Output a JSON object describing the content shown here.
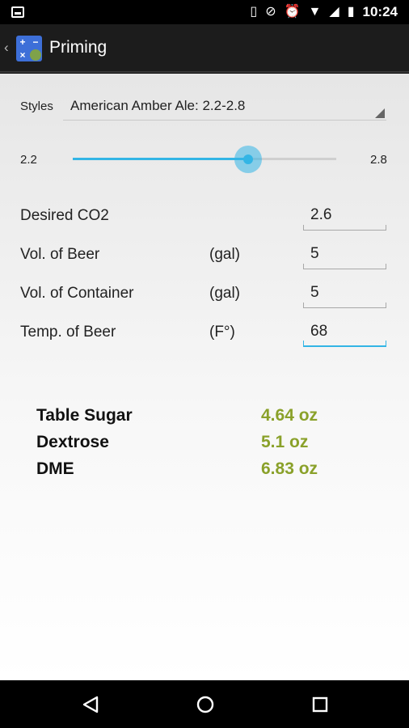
{
  "status_bar": {
    "time": "10:24",
    "icons": [
      "image-icon",
      "vibrate-icon",
      "do-not-disturb-icon",
      "alarm-icon",
      "wifi-icon",
      "signal-icon",
      "battery-icon"
    ]
  },
  "app_bar": {
    "title": "Priming",
    "icon": "calculator-app-icon",
    "icon_glyphs": [
      "+",
      "−",
      "×",
      ""
    ]
  },
  "styles": {
    "label": "Styles",
    "selected": "American Amber Ale: 2.2-2.8"
  },
  "slider": {
    "min_label": "2.2",
    "max_label": "2.8",
    "min": 2.2,
    "max": 2.8,
    "value": 2.6,
    "accent_color": "#33b5e5"
  },
  "inputs": [
    {
      "label": "Desired CO2",
      "unit": "",
      "value": "2.6"
    },
    {
      "label": "Vol. of Beer",
      "unit": "(gal)",
      "value": "5"
    },
    {
      "label": "Vol. of Container",
      "unit": "(gal)",
      "value": "5"
    },
    {
      "label": "Temp. of Beer",
      "unit": "(F°)",
      "value": "68"
    }
  ],
  "results": [
    {
      "label": "Table Sugar",
      "value": "4.64 oz"
    },
    {
      "label": "Dextrose",
      "value": "5.1 oz"
    },
    {
      "label": "DME",
      "value": "6.83 oz"
    }
  ],
  "colors": {
    "result_value": "#8aa12a",
    "accent": "#33b5e5"
  },
  "nav_bar": {
    "buttons": [
      "back-icon",
      "home-icon",
      "recent-apps-icon"
    ]
  }
}
